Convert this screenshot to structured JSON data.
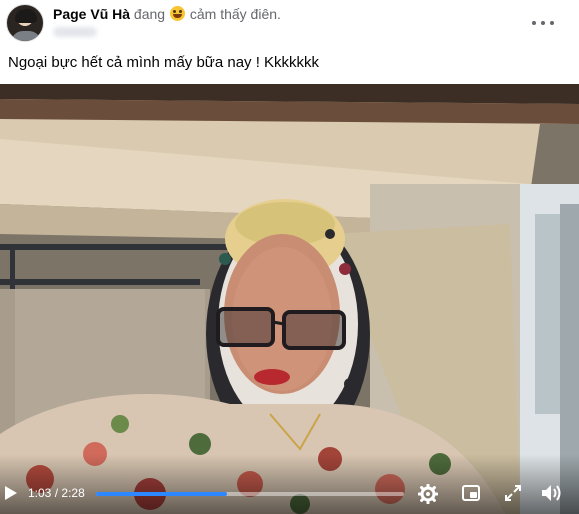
{
  "post": {
    "author": "Page Vũ Hà",
    "action_prefix": "đang",
    "feeling_icon": "grinning-tongue-emoji",
    "action_suffix": "cảm thấy điên.",
    "more_icon": "more-horizontal-icon",
    "caption": "Ngoại bực hết cả mình mấy bữa nay ! Kkkkkkk"
  },
  "video": {
    "time_current": "1:03",
    "time_separator": "/",
    "time_total": "2:28",
    "progress": 0.426,
    "icons": {
      "play": "play-icon",
      "settings": "gear-icon",
      "pip": "picture-in-picture-icon",
      "fullscreen": "fullscreen-icon",
      "volume": "volume-icon"
    },
    "colors": {
      "progress_fill": "#2d88ff",
      "progress_track": "rgba(255,255,255,0.45)"
    }
  }
}
